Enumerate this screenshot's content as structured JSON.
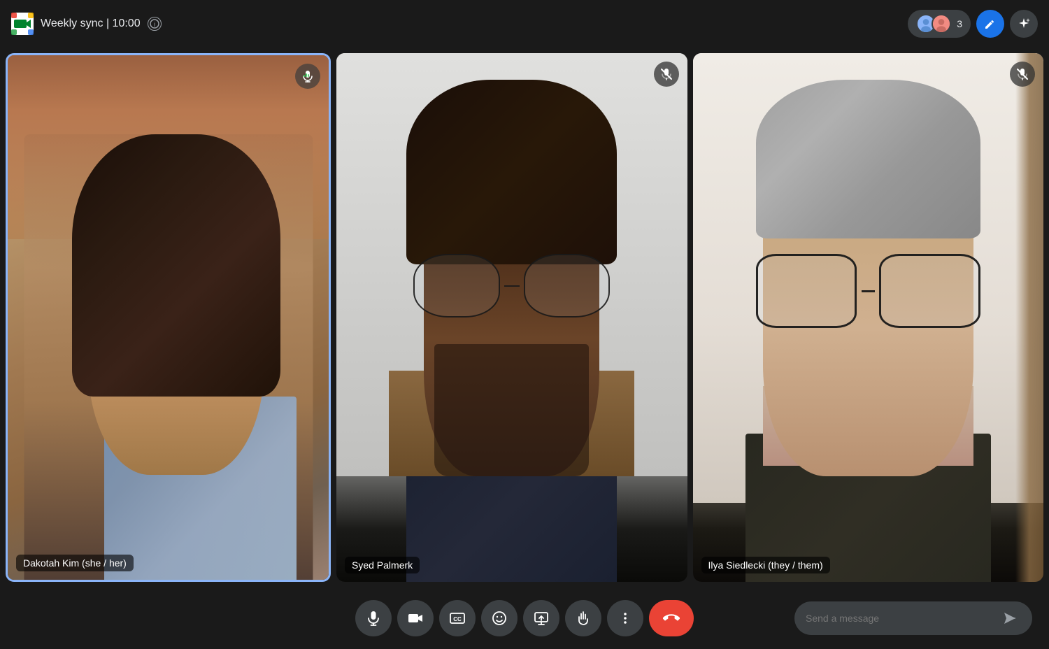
{
  "header": {
    "title": "Weekly sync | 10:00",
    "logo_alt": "Google Meet",
    "info_tooltip": "Meeting info",
    "participants_count": "3",
    "pencil_label": "Edit",
    "sparkle_label": "AI features"
  },
  "participants": [
    {
      "id": "dakotah",
      "name": "Dakotah Kim (she / her)",
      "is_active_speaker": true,
      "is_muted": false,
      "mic_icon": "mic-active"
    },
    {
      "id": "syed",
      "name": "Syed Palmerk",
      "is_active_speaker": false,
      "is_muted": true,
      "mic_icon": "mic-muted"
    },
    {
      "id": "ilya",
      "name": "Ilya Siedlecki (they / them)",
      "is_active_speaker": false,
      "is_muted": true,
      "mic_icon": "mic-muted"
    }
  ],
  "toolbar": {
    "mic_label": "Microphone",
    "camera_label": "Camera",
    "captions_label": "Captions",
    "emoji_label": "Emoji reactions",
    "present_label": "Present now",
    "raise_hand_label": "Raise hand",
    "more_label": "More options",
    "end_call_label": "Leave call"
  },
  "chat": {
    "placeholder": "Send a message",
    "send_label": "Send"
  }
}
